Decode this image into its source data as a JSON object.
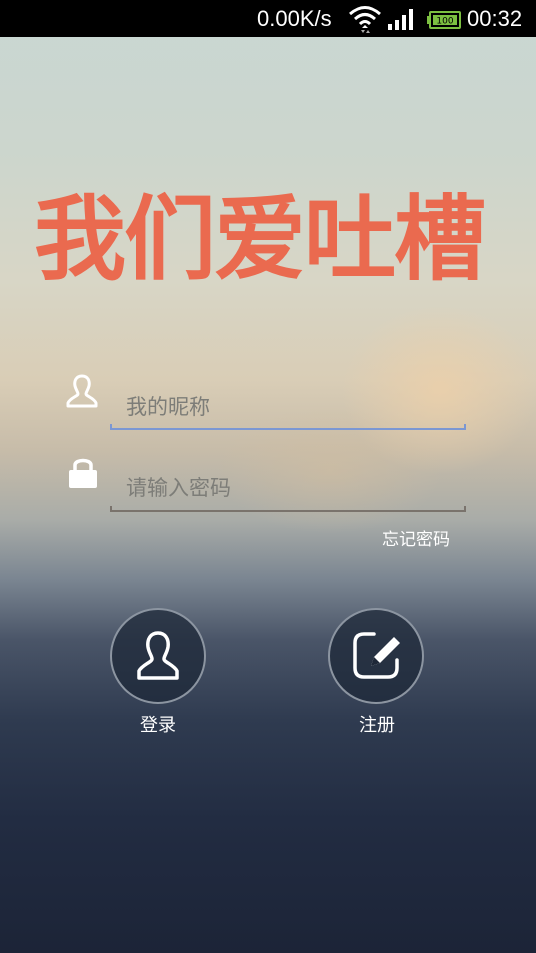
{
  "status_bar": {
    "speed": "0.00K/s",
    "time": "00:32",
    "battery_level": "100",
    "icons": [
      "wifi-icon",
      "signal-icon",
      "battery-icon"
    ]
  },
  "app": {
    "logo_text": "我们爱吐槽",
    "logo_color": "#ea6a4f"
  },
  "login_form": {
    "nickname_placeholder": "我的昵称",
    "nickname_value": "",
    "password_placeholder": "请输入密码",
    "password_value": "",
    "forgot_password_label": "忘记密码",
    "icons": [
      "user-icon",
      "lock-icon"
    ]
  },
  "actions": {
    "login_label": "登录",
    "register_label": "注册",
    "icons": [
      "person-icon",
      "edit-icon"
    ]
  }
}
